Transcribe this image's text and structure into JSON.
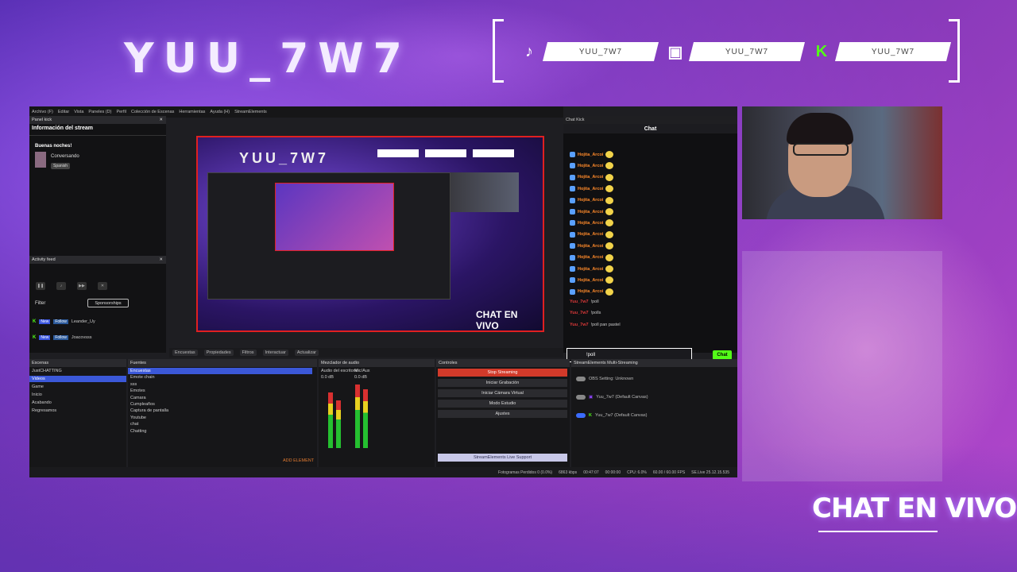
{
  "overlay": {
    "title": "YUU_7W7",
    "socials": [
      {
        "icon": "tiktok-icon",
        "glyph": "♪",
        "handle": "YUU_7W7"
      },
      {
        "icon": "twitch-icon",
        "glyph": "▣",
        "handle": "YUU_7W7"
      },
      {
        "icon": "kick-icon",
        "glyph": "K",
        "handle": "YUU_7W7"
      }
    ],
    "chat_label": "CHAT EN VIVO"
  },
  "obs": {
    "menu": [
      "Archivo (F)",
      "Editar",
      "Vista",
      "Paneles (D)",
      "Perfil",
      "Colección de Escenas",
      "Herramientas",
      "Ayuda (H)",
      "StreamElements"
    ],
    "kick_panel": {
      "header": "Panel kick",
      "title": "Información del stream",
      "greeting": "Buenas noches!",
      "status": "Conversando",
      "language": "Spanish"
    },
    "activity": {
      "header": "Activity feed",
      "filter": "Filter",
      "sponsorships": "Sponsorships",
      "rows": [
        {
          "new": "New",
          "follow": "Follow",
          "name": "Leander_Uy"
        },
        {
          "new": "New",
          "follow": "Follow",
          "name": "Joacovsss"
        }
      ]
    },
    "preview": {
      "title": "YUU_7W7",
      "chat_label": "CHAT EN VIVO"
    },
    "preview_bar": {
      "scene_label": "Encuestas",
      "properties": "Propiedades",
      "filters": "Filtros",
      "interact": "Interactuar",
      "refresh": "Actualizar"
    },
    "chat": {
      "header": "Chat Kick",
      "title": "Chat",
      "repeated_user": "Hojita_Arcoi",
      "user": "Yuu_7w7",
      "messages": [
        {
          "user": "Yuu_7w7",
          "text": "!poll"
        },
        {
          "user": "Yuu_7w7",
          "text": "!polls"
        },
        {
          "user": "Yuu_7w7",
          "text": "!poll pan pastel"
        }
      ],
      "input_value": "!poll",
      "send_label": "Chat"
    },
    "scenes": {
      "header": "Escenas",
      "items": [
        "JustCHATTING",
        "Videos",
        "Game",
        "Inicio",
        "Acabando",
        "Regresamos"
      ],
      "selected": 1
    },
    "sources": {
      "header": "Fuentes",
      "items": [
        "Encuestas",
        "Emote chain",
        "sss",
        "Emotes",
        "Camara",
        "Cumpleaños",
        "Captura de pantalla",
        "Youtube",
        "chat",
        "Chatting"
      ],
      "selected": 0,
      "add_element": "ADD ELEMENT"
    },
    "mixer": {
      "header": "Mezclador de audio",
      "channels": [
        "Audio del escritorio",
        "Mic/Aux"
      ],
      "levels": [
        "0.0 dB",
        "0.0 dB"
      ]
    },
    "controls": {
      "header": "Controles",
      "buttons": [
        "Stop Streaming",
        "Iniciar Grabación",
        "Iniciar Cámara Virtual",
        "Modo Estudio",
        "Ajustes"
      ],
      "link": "StreamElements Live Support"
    },
    "multistream": {
      "header": "StreamElements Multi-Streaming",
      "rows": [
        {
          "label": "OBS Setting: Unknown"
        },
        {
          "label": "Yuu_7w7 (Default Canvas)"
        },
        {
          "label": "Yuu_7w7 (Default Canvas)"
        }
      ]
    },
    "status": {
      "dropped": "Fotogramas Perdidos 0 (0.0%)",
      "kbps": "6863 kbps",
      "live": "00:47:07",
      "rec": "00:00:00",
      "cpu": "CPU: 6.0%",
      "fps": "60.00 / 60.00 FPS",
      "version": "SE.Live 25.12.15.535"
    }
  },
  "colors": {
    "accent_kick": "#53fc18",
    "stop_red": "#d23a2a",
    "selection_blue": "#3b58d8"
  }
}
